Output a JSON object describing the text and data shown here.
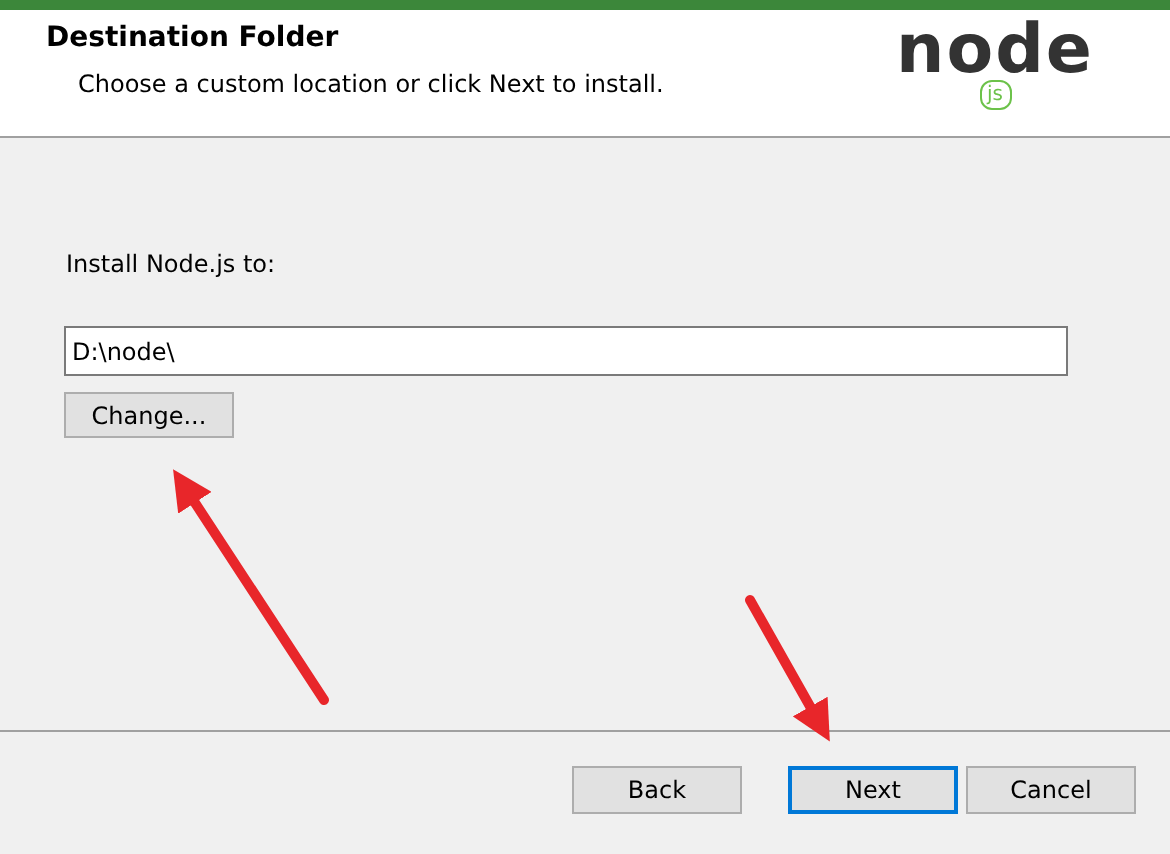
{
  "header": {
    "title": "Destination Folder",
    "subtitle": "Choose a custom location or click Next to install.",
    "logo": {
      "text": "node",
      "badge": "js"
    }
  },
  "body": {
    "label": "Install Node.js to:",
    "path": {
      "value": "D:\\node\\"
    },
    "change_button": "Change..."
  },
  "buttons": [
    {
      "label": "Back",
      "default": false
    },
    {
      "label": "Next",
      "default": true
    },
    {
      "label": "Cancel",
      "default": false
    }
  ]
}
